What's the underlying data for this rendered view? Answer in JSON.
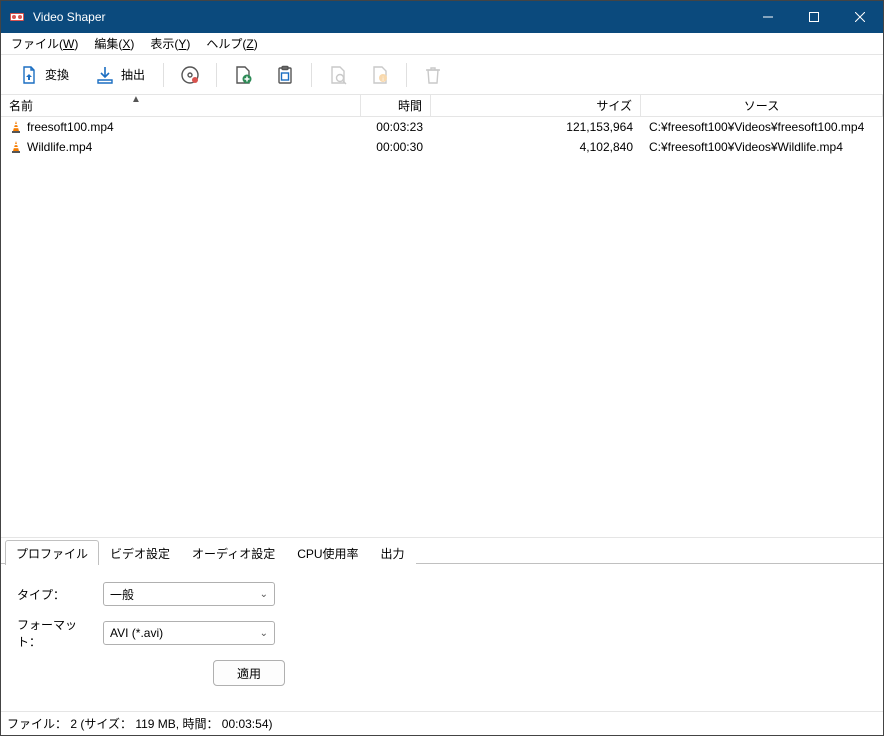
{
  "window": {
    "title": "Video Shaper"
  },
  "menu": {
    "file": {
      "label": "ファイル",
      "mnemonic": "W"
    },
    "edit": {
      "label": "編集",
      "mnemonic": "X"
    },
    "view": {
      "label": "表示",
      "mnemonic": "Y"
    },
    "help": {
      "label": "ヘルプ",
      "mnemonic": "Z"
    }
  },
  "toolbar": {
    "convert": "変換",
    "extract": "抽出"
  },
  "columns": {
    "name": "名前",
    "time": "時間",
    "size": "サイズ",
    "source": "ソース"
  },
  "files": [
    {
      "name": "freesoft100.mp4",
      "time": "00:03:23",
      "size": "121,153,964",
      "source": "C:¥freesoft100¥Videos¥freesoft100.mp4"
    },
    {
      "name": "Wildlife.mp4",
      "time": "00:00:30",
      "size": "4,102,840",
      "source": "C:¥freesoft100¥Videos¥Wildlife.mp4"
    }
  ],
  "tabs": {
    "profile": "プロファイル",
    "video": "ビデオ設定",
    "audio": "オーディオ設定",
    "cpu": "CPU使用率",
    "output": "出力"
  },
  "profile": {
    "type_label": "タイプ：",
    "type_value": "一般",
    "format_label": "フォーマット：",
    "format_value": "AVI (*.avi)",
    "apply": "適用"
  },
  "status": {
    "text": "ファイル： 2 (サイズ： 119 MB, 時間： 00:03:54)"
  }
}
